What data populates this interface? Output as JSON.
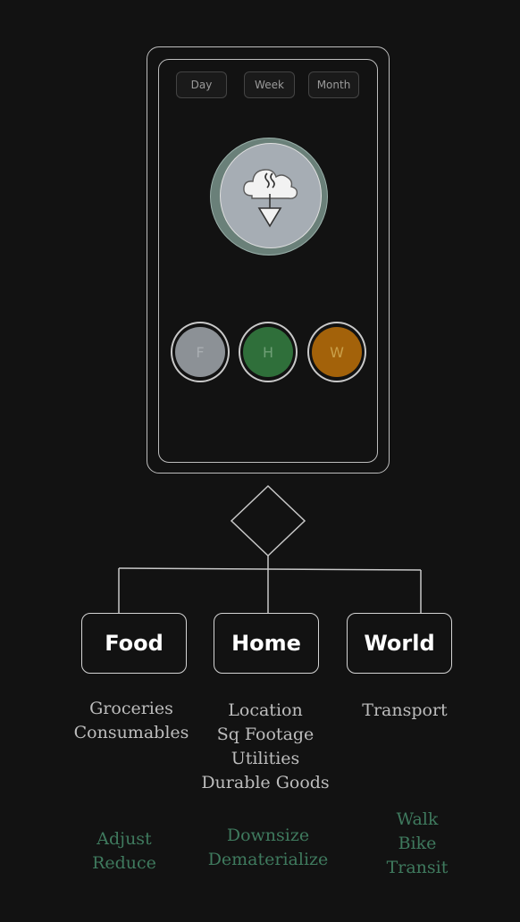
{
  "range_tabs": [
    "Day",
    "Week",
    "Month"
  ],
  "main_icon": "cloud-co2-download-icon",
  "category_buttons": [
    {
      "letter": "F",
      "color": "#8c9196",
      "text_color": "#a9aeb2"
    },
    {
      "letter": "H",
      "color": "#2f6f3a",
      "text_color": "#6e9f75"
    },
    {
      "letter": "W",
      "color": "#a3620a",
      "text_color": "#caa04a"
    }
  ],
  "categories": [
    {
      "title": "Food",
      "items": [
        "Groceries",
        "Consumables"
      ],
      "actions": [
        "Adjust",
        "Reduce"
      ]
    },
    {
      "title": "Home",
      "items": [
        "Location",
        "Sq Footage",
        "Utilities",
        "Durable Goods"
      ],
      "actions": [
        "Downsize",
        "Dematerialize"
      ]
    },
    {
      "title": "World",
      "items": [
        "Transport"
      ],
      "actions": [
        "Walk",
        "Bike",
        "Transit"
      ]
    }
  ],
  "colors": {
    "background": "#121212",
    "accent_green": "#3f7a5e",
    "ring": "#6a8079",
    "face": "#a6adb4"
  }
}
